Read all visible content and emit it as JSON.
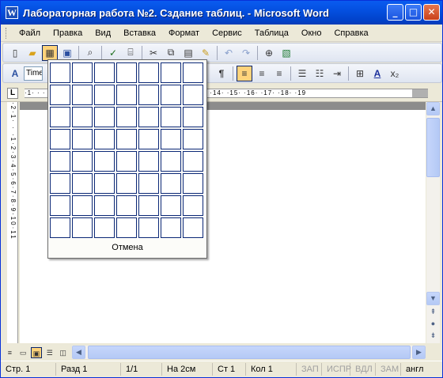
{
  "window": {
    "title": "Лабораторная работа №2. Сздание таблиц. - Microsoft Word",
    "app_icon": "W",
    "buttons": {
      "minimize": "_",
      "maximize": "□",
      "close": "✕"
    }
  },
  "menu": {
    "items": [
      "Файл",
      "Правка",
      "Вид",
      "Вставка",
      "Формат",
      "Сервис",
      "Таблица",
      "Окно",
      "Справка"
    ]
  },
  "toolbar_standard": {
    "icons": [
      "new-doc-icon",
      "open-icon",
      "insert-table-icon",
      "save-icon",
      "print-preview-icon",
      "spelling-icon",
      "research-icon",
      "cut-icon",
      "copy-icon",
      "paste-icon",
      "format-painter-icon",
      "undo-icon",
      "redo-icon",
      "insert-hyperlink-icon",
      "excel-icon"
    ]
  },
  "toolbar_formatting": {
    "font_name": "Time",
    "style_glyph": "A",
    "paragraph_glyph": "¶",
    "font_color_glyph": "A",
    "subscript_glyph": "x₂"
  },
  "ruler": {
    "corner": "L",
    "horizontal_ticks": "·1·  ·  ·  ·  ·  ·  ·  ·  ·  ·  ·  ·  ·  ·  ·  ·  ·  · ·9· ·10· ·11· ·12· ·13· ·14· ·15· ·16· ·17· ·18· ·19",
    "vertical_ticks": "·2·1· · ·1·2·3·4·5·6·7·8·9·10·11"
  },
  "table_picker": {
    "rows": 8,
    "columns": 7,
    "cancel_label": "Отмена"
  },
  "status": {
    "page": "Стр. 1",
    "section": "Разд 1",
    "pages": "1/1",
    "position": "На 2см",
    "line": "Ст 1",
    "column": "Кол 1",
    "rec": "ЗАП",
    "trk": "ИСПР",
    "ext": "ВДЛ",
    "ovr": "ЗАМ",
    "language": "англ"
  }
}
